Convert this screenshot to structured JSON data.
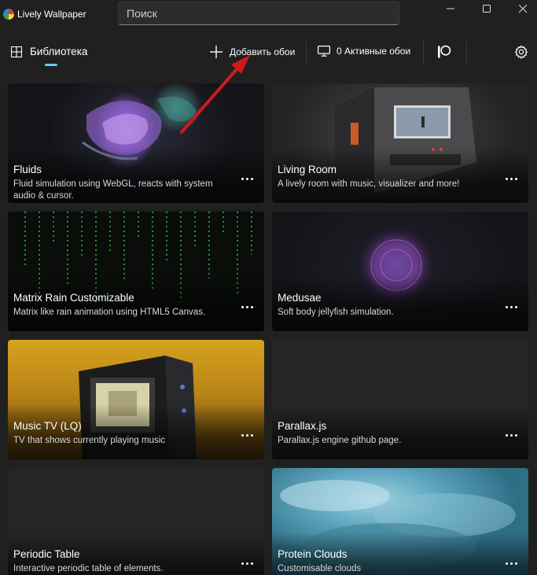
{
  "app": {
    "title": "Lively Wallpaper"
  },
  "search": {
    "placeholder": "Поиск"
  },
  "nav": {
    "library_label": "Библиотека",
    "add_wallpaper_label": "Добавить обои",
    "active_wallpapers_label": "0 Активные обои"
  },
  "icons": {
    "app_logo": "lively-logo-icon",
    "library": "grid-icon",
    "add": "plus-icon",
    "monitor": "monitor-icon",
    "patreon": "patreon-icon",
    "settings": "gear-icon",
    "more": "more-dots-icon"
  },
  "colors": {
    "accent": "#60cdff",
    "annotation_arrow": "#d0191d",
    "background": "#202020"
  },
  "wallpapers": [
    {
      "title": "Fluids",
      "description": "Fluid simulation using WebGL, reacts with system audio & cursor."
    },
    {
      "title": "Living Room",
      "description": "A lively room with music, visualizer and more!"
    },
    {
      "title": "Matrix Rain Customizable",
      "description": "Matrix like rain animation using HTML5 Canvas."
    },
    {
      "title": "Medusae",
      "description": "Soft body jellyfish simulation."
    },
    {
      "title": "Music TV (LQ)",
      "description": "TV that shows currently playing music"
    },
    {
      "title": "Parallax.js",
      "description": "Parallax.js engine github page."
    },
    {
      "title": "Periodic Table",
      "description": "Interactive periodic table of elements."
    },
    {
      "title": "Protein Clouds",
      "description": "Customisable clouds"
    }
  ]
}
